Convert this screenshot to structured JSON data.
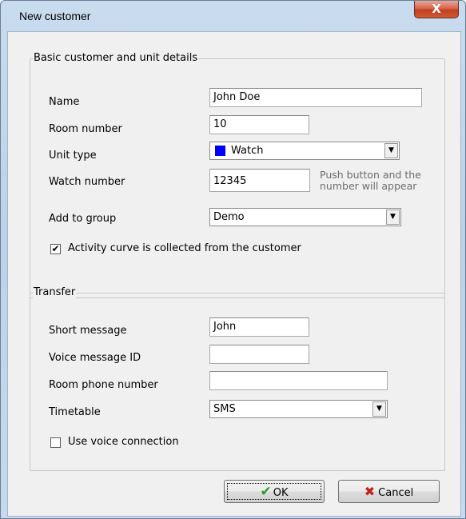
{
  "window": {
    "title": "New customer",
    "close_glyph": "X"
  },
  "basic": {
    "legend": "Basic customer and unit details",
    "name_label": "Name",
    "name_value": "John Doe",
    "room_label": "Room number",
    "room_value": "10",
    "unit_type_label": "Unit type",
    "unit_type_value": "Watch",
    "unit_type_color": "#0000ff",
    "watch_number_label": "Watch number",
    "watch_number_value": "12345",
    "watch_hint_line1": "Push button and the",
    "watch_hint_line2": "number will appear",
    "group_label": "Add to group",
    "group_value": "Demo",
    "activity_label": "Activity curve is collected from the customer",
    "activity_checked": true
  },
  "transfer": {
    "legend": "Transfer",
    "short_message_label": "Short message",
    "short_message_value": "John",
    "voice_id_label": "Voice message ID",
    "voice_id_value": "",
    "room_phone_label": "Room phone number",
    "room_phone_value": "",
    "timetable_label": "Timetable",
    "timetable_value": "SMS",
    "voice_connection_label": "Use voice connection",
    "voice_connection_checked": false
  },
  "buttons": {
    "ok": "OK",
    "cancel": "Cancel"
  },
  "icons": {
    "ok": "check-icon",
    "cancel": "cross-icon",
    "dropdown": "chevron-down-icon"
  }
}
